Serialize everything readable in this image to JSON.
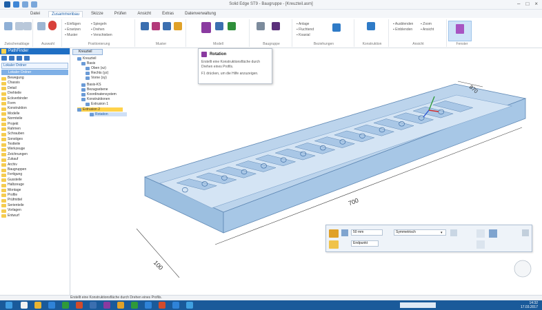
{
  "window": {
    "title": "Solid Edge ST9 - Baugruppe - [Kreuzteil.asm]",
    "controls": [
      "–",
      "□",
      "×"
    ]
  },
  "ribbon": {
    "tabs": [
      "Datei",
      "Zusammenbau",
      "Skizze",
      "Prüfen",
      "Ansicht",
      "Extras",
      "Datenverwaltung"
    ],
    "active_tab_index": 1,
    "groups": [
      "Zwischenablage",
      "Auswahl",
      "Positionierung",
      "Muster",
      "Modell",
      "Baugruppe",
      "Beziehungen",
      "Konstruktion",
      "Ansicht",
      "Fenster"
    ],
    "highlighted_button": "Rotation",
    "accent_color": "#1f6fc4"
  },
  "tooltip": {
    "title": "Rotation",
    "description": "Erstellt eine Konstruktionsfläche durch Drehen eines Profils.",
    "help": "F1 drücken, um die Hilfe anzuzeigen."
  },
  "library": {
    "header": "PathFinder",
    "path": "Lokaler Ordner",
    "selected_folder": "Lokaler Ordner",
    "folders": [
      "Bewegung",
      "Chassis",
      "Detail",
      "Drehteile",
      "Eckverbinder",
      "Form",
      "Konstruktion",
      "Modelle",
      "Normteile",
      "Projekt",
      "Rahmen",
      "Schrauben",
      "Sonstiges",
      "Testteile",
      "Werkzeuge",
      "Zeichnungen",
      "Zukauf",
      "Archiv",
      "Baugruppen",
      "Fertigung",
      "Gussteile",
      "Halbzeuge",
      "Montage",
      "Profile",
      "Prüfmittel",
      "Serienteile",
      "Vorlagen",
      "Entwurf"
    ]
  },
  "tree": {
    "tab_label": "Kreuzteil",
    "nodes": [
      "Kreuzteil",
      "Basis",
      "Oben (xz)",
      "Rechts (yz)",
      "Vorne (xy)",
      "Basis-KS",
      "Bezugsebene",
      "Koordinatensystem",
      "Konstruktionen",
      "Extrusion 1",
      "Extrusion 2",
      "Rotation"
    ]
  },
  "drawing": {
    "dimensions": [
      "700",
      "100",
      "870"
    ]
  },
  "floatbar": {
    "fields": [
      "50 mm",
      "Endpunkt",
      "Symmetrisch"
    ]
  },
  "status": {
    "text": "Erstellt eine Konstruktionsfläche durch Drehen eines Profils."
  },
  "taskbar": {
    "clock": "14:32",
    "date": "17.03.2017"
  }
}
